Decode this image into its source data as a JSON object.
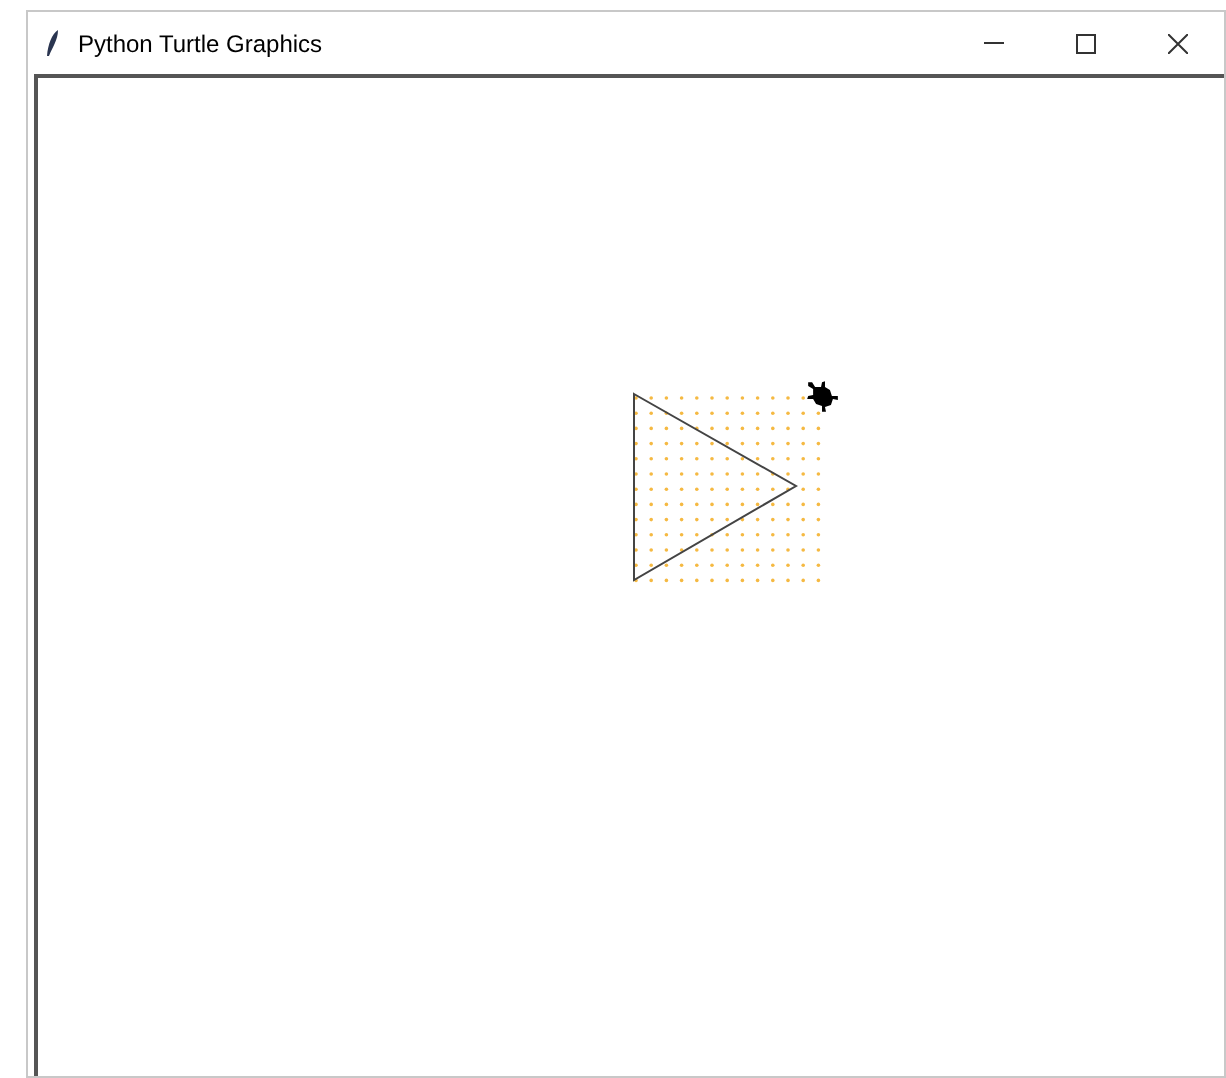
{
  "window": {
    "title": "Python Turtle Graphics"
  }
}
